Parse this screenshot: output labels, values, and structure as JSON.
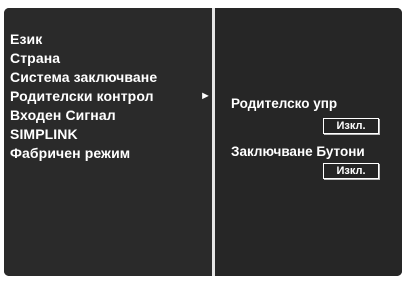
{
  "menu": {
    "items": [
      {
        "label": "Език"
      },
      {
        "label": "Страна"
      },
      {
        "label": "Система заключване"
      },
      {
        "label": "Родителски контрол",
        "arrow": "►"
      },
      {
        "label": "Входен Сигнал"
      },
      {
        "label": "SIMPLINK"
      },
      {
        "label": "Фабричен режим"
      }
    ]
  },
  "submenu": {
    "parental_control": {
      "label": "Родителско упр",
      "value": "Изкл."
    },
    "key_lock": {
      "label": "Заключване Бутони",
      "value": "Изкл."
    }
  },
  "colors": {
    "background": "#1d1d1d",
    "text": "#ffffff",
    "divider": "#e6e6e6"
  }
}
